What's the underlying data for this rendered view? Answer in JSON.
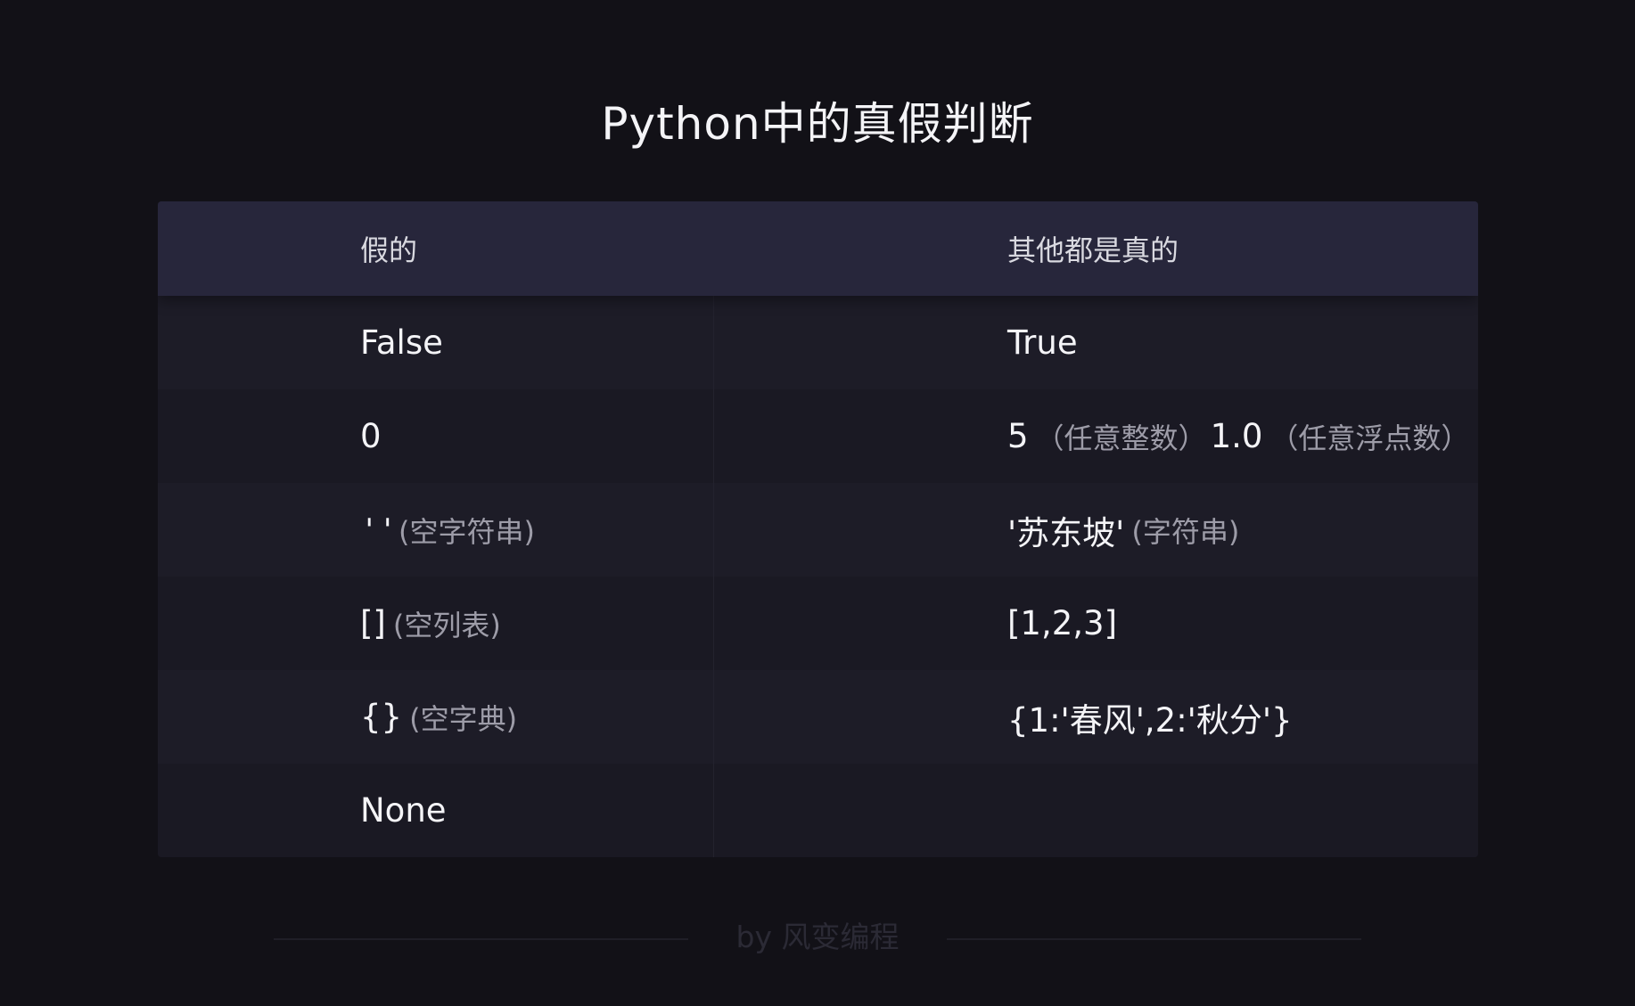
{
  "title": "Python中的真假判断",
  "table": {
    "headers": [
      "假的",
      "其他都是真的"
    ],
    "rows": [
      {
        "false_value": "False",
        "false_note": "",
        "true_value": "True",
        "true_note": "",
        "true_value2": "",
        "true_note2": ""
      },
      {
        "false_value": "0",
        "false_note": "",
        "true_value": "5",
        "true_note": "（任意整数）",
        "true_value2": "1.0",
        "true_note2": "（任意浮点数）"
      },
      {
        "false_value": "''",
        "false_note": "(空字符串)",
        "true_value": "'苏东坡'",
        "true_note": "(字符串)",
        "true_value2": "",
        "true_note2": ""
      },
      {
        "false_value": "[]",
        "false_note": "(空列表)",
        "true_value": "[1,2,3]",
        "true_note": "",
        "true_value2": "",
        "true_note2": ""
      },
      {
        "false_value": "{}",
        "false_note": "(空字典)",
        "true_value": "{1:'春风',2:'秋分'}",
        "true_note": "",
        "true_value2": "",
        "true_note2": ""
      },
      {
        "false_value": "None",
        "false_note": "",
        "true_value": "",
        "true_note": "",
        "true_value2": "",
        "true_note2": ""
      }
    ]
  },
  "footer": {
    "text": "by 风变编程"
  }
}
